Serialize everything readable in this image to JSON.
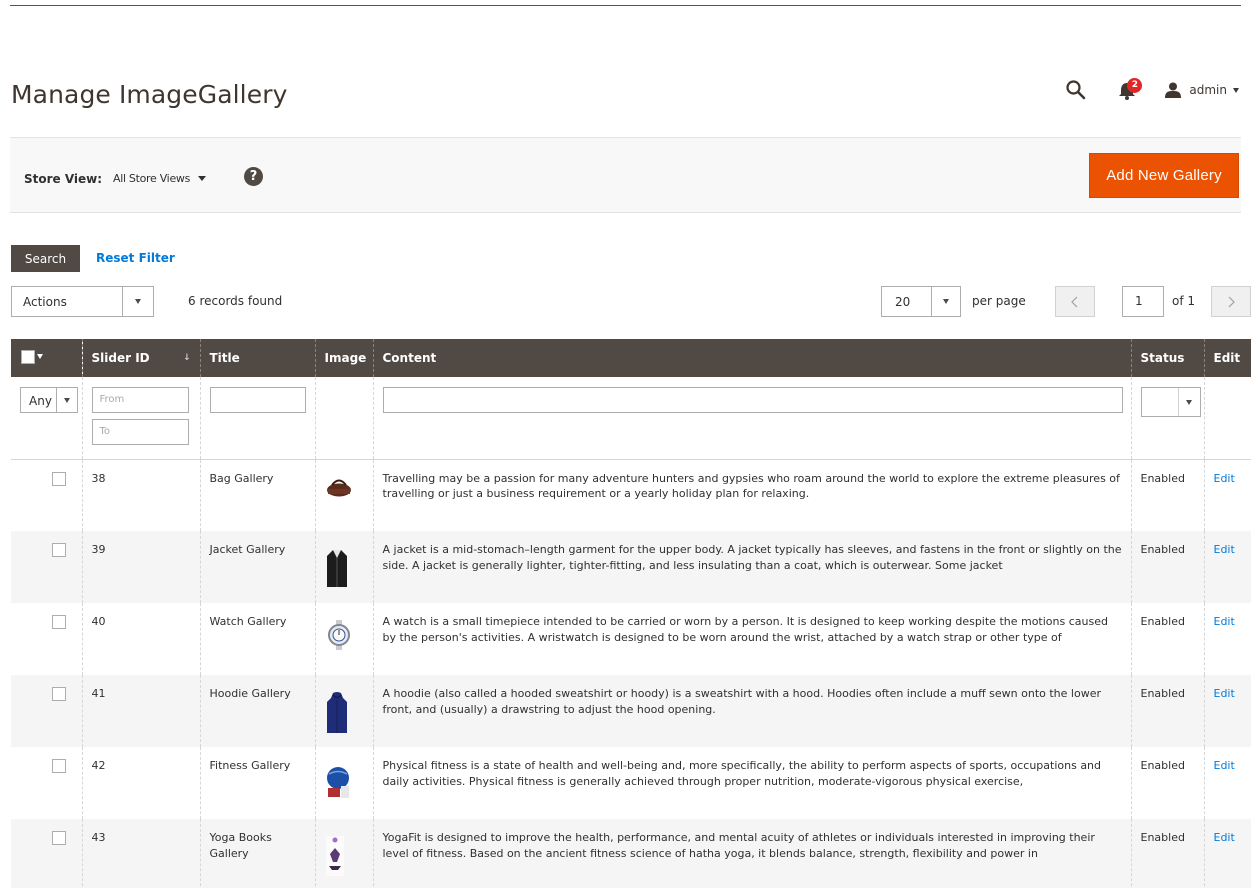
{
  "page": {
    "title": "Manage ImageGallery"
  },
  "header": {
    "notifications_count": "2",
    "user_name": "admin"
  },
  "store_bar": {
    "label": "Store View:",
    "selected": "All Store Views",
    "help": "?",
    "add_button": "Add New Gallery"
  },
  "filters_bar": {
    "search_button": "Search",
    "reset_link": "Reset Filter",
    "actions_label": "Actions",
    "records_found": "6 records found",
    "per_page_value": "20",
    "per_page_label": "per page",
    "page_value": "1",
    "page_of": "of 1",
    "prev_icon": "chevron-left-icon",
    "next_icon": "chevron-right-icon"
  },
  "columns": {
    "slider_id": "Slider ID",
    "title": "Title",
    "image": "Image",
    "content": "Content",
    "status": "Status",
    "edit": "Edit"
  },
  "column_filters": {
    "any": "Any",
    "from_placeholder": "From",
    "to_placeholder": "To"
  },
  "rows": [
    {
      "id": "38",
      "title": "Bag Gallery",
      "image": "bag",
      "content": "Travelling may be a passion for many adventure hunters and gypsies who roam around the world to explore the extreme pleasures of travelling or just a business requirement or a yearly holiday plan for relaxing.",
      "status": "Enabled",
      "edit": "Edit"
    },
    {
      "id": "39",
      "title": "Jacket Gallery",
      "image": "jacket",
      "content": "A jacket is a mid-stomach–length garment for the upper body. A jacket typically has sleeves, and fastens in the front or slightly on the side. A jacket is generally lighter, tighter-fitting, and less insulating than a coat, which is outerwear. Some jacket",
      "status": "Enabled",
      "edit": "Edit"
    },
    {
      "id": "40",
      "title": "Watch Gallery",
      "image": "watch",
      "content": "A watch is a small timepiece intended to be carried or worn by a person. It is designed to keep working despite the motions caused by the person's activities. A wristwatch is designed to be worn around the wrist, attached by a watch strap or other type of",
      "status": "Enabled",
      "edit": "Edit"
    },
    {
      "id": "41",
      "title": "Hoodie Gallery",
      "image": "hoodie",
      "content": "A hoodie (also called a hooded sweatshirt or hoody) is a sweatshirt with a hood. Hoodies often include a muff sewn onto the lower front, and (usually) a drawstring to adjust the hood opening.",
      "status": "Enabled",
      "edit": "Edit"
    },
    {
      "id": "42",
      "title": "Fitness Gallery",
      "image": "fitness",
      "content": "Physical fitness is a state of health and well-being and, more specifically, the ability to perform aspects of sports, occupations and daily activities. Physical fitness is generally achieved through proper nutrition, moderate-vigorous physical exercise,",
      "status": "Enabled",
      "edit": "Edit"
    },
    {
      "id": "43",
      "title": "Yoga Books Gallery",
      "image": "yoga",
      "content": "YogaFit is designed to improve the health, performance, and mental acuity of athletes or individuals interested in improving their level of fitness. Based on the ancient fitness science of hatha yoga, it blends balance, strength, flexibility and power in",
      "status": "Enabled",
      "edit": "Edit"
    }
  ],
  "colors": {
    "accent": "#eb5202",
    "header_dark": "#514943",
    "link": "#007bdb",
    "badge": "#e22626"
  }
}
